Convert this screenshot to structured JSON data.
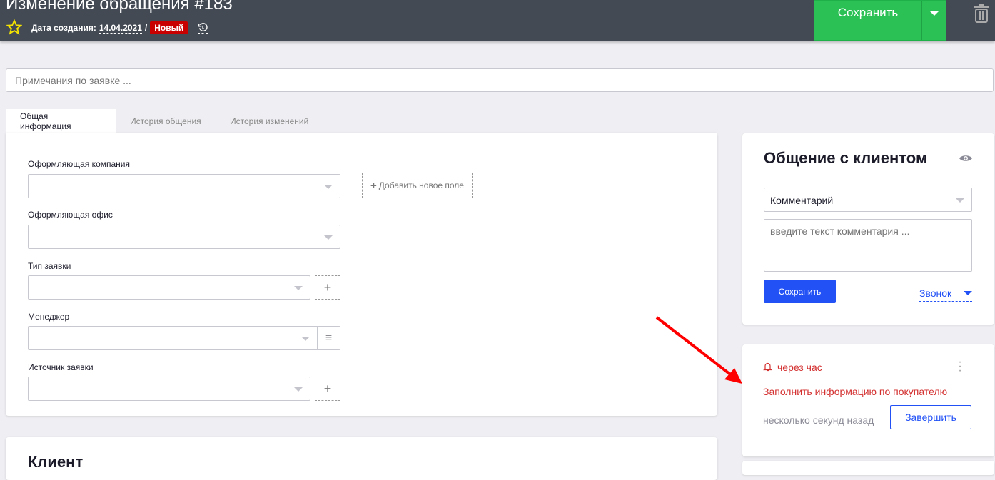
{
  "header": {
    "title": "Изменение обращения #183",
    "date_label": "Дата создания:",
    "date": "14.04.2021",
    "separator": "/",
    "status": "Новый",
    "save_label": "Сохранить"
  },
  "notes": {
    "placeholder": "Примечания по заявке ..."
  },
  "tabs": [
    {
      "label": "Общая информация"
    },
    {
      "label": "История общения"
    },
    {
      "label": "История изменений"
    }
  ],
  "form": {
    "fields": [
      {
        "label": "Оформляющая компания"
      },
      {
        "label": "Оформляющая офис"
      },
      {
        "label": "Тип заявки"
      },
      {
        "label": "Менеджер"
      },
      {
        "label": "Источник заявки"
      }
    ],
    "add_field": "Добавить новое поле"
  },
  "client": {
    "title": "Клиент"
  },
  "communication": {
    "title": "Общение с клиентом",
    "type": "Комментарий",
    "placeholder": "введите текст комментария ...",
    "save": "Сохранить",
    "call": "Звонок"
  },
  "reminder": {
    "time": "через час",
    "text": "Заполнить информацию по покупателю",
    "ago": "несколько секунд назад",
    "complete": "Завершить"
  },
  "colors": {
    "header": "#434a54",
    "save": "#2bc155",
    "primary": "#2251f6",
    "danger": "#d32f2f"
  }
}
